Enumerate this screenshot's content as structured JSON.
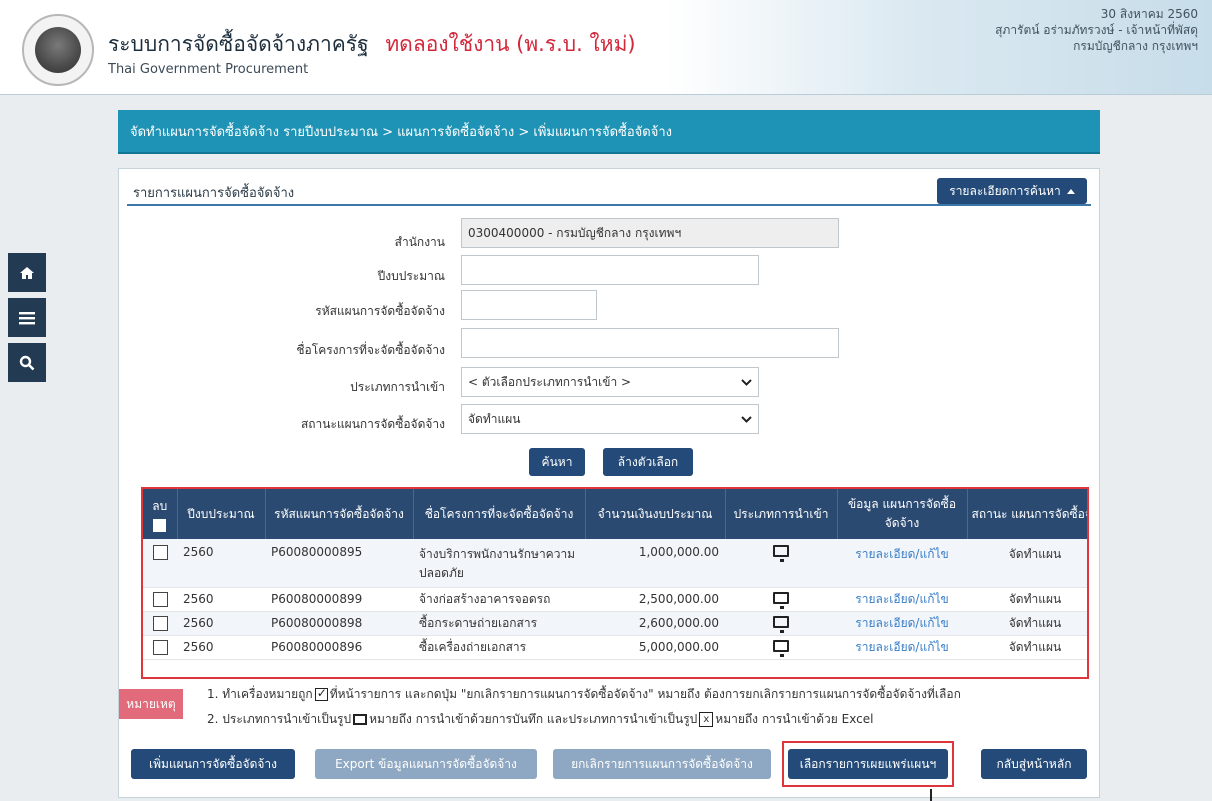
{
  "header": {
    "title": "ระบบการจัดซื้อจัดจ้างภาครัฐ",
    "trial_label": "ทดลองใช้งาน (พ.ร.บ. ใหม่)",
    "subtitle": "Thai Government Procurement",
    "date": "30 สิงหาคม 2560",
    "user": "สุภารัตน์ อร่ามภัทรวงษ์ - เจ้าหน้าที่พัสดุ",
    "department": "กรมบัญชีกลาง กรุงเทพฯ"
  },
  "sidenav": {
    "icons": [
      "home-icon",
      "menu-icon",
      "search-icon"
    ]
  },
  "breadcrumb": "จัดทำแผนการจัดซื้อจัดจ้าง รายปีงบประมาณ > แผนการจัดซื้อจัดจ้าง > เพิ่มแผนการจัดซื้อจัดจ้าง",
  "panel": {
    "title": "รายการแผนการจัดซื้อจัดจ้าง",
    "search_detail_button": "รายละเอียดการค้นหา"
  },
  "form": {
    "office_label": "สำนักงาน",
    "office_value": "0300400000 - กรมบัญชีกลาง กรุงเทพฯ",
    "budget_year_label": "ปีงบประมาณ",
    "budget_year_value": "",
    "plan_code_label": "รหัสแผนการจัดซื้อจัดจ้าง",
    "plan_code_value": "",
    "project_name_label": "ชื่อโครงการที่จะจัดซื้อจัดจ้าง",
    "project_name_value": "",
    "import_type_label": "ประเภทการนำเข้า",
    "import_type_value": "< ตัวเลือกประเภทการนำเข้า >",
    "plan_status_label": "สถานะแผนการจัดซื้อจัดจ้าง",
    "plan_status_value": "จัดทำแผน",
    "search_button": "ค้นหา",
    "clear_button": "ล้างตัวเลือก"
  },
  "table": {
    "headers": {
      "delete": "ลบ",
      "budget_year": "ปีงบประมาณ",
      "plan_code": "รหัสแผนการจัดซื้อจัดจ้าง",
      "project_name": "ชื่อโครงการที่จะจัดซื้อจัดจ้าง",
      "budget_amount": "จำนวนเงินงบประมาณ",
      "import_type": "ประเภทการนำเข้า",
      "plan_info": "ข้อมูล แผนการจัดซื้อจัดจ้าง",
      "status": "สถานะ แผนการจัดซื้อจัดจ้"
    },
    "rows": [
      {
        "year": "2560",
        "code": "P60080000895",
        "name": "จ้างบริการพนักงานรักษาความปลอดภัย",
        "amount": "1,000,000.00",
        "import_icon": "monitor-icon",
        "info": "รายละเอียด/แก้ไข",
        "status": "จัดทำแผน"
      },
      {
        "year": "2560",
        "code": "P60080000899",
        "name": "จ้างก่อสร้างอาคารจอดรถ",
        "amount": "2,500,000.00",
        "import_icon": "monitor-icon",
        "info": "รายละเอียด/แก้ไข",
        "status": "จัดทำแผน"
      },
      {
        "year": "2560",
        "code": "P60080000898",
        "name": "ซื้อกระดาษถ่ายเอกสาร",
        "amount": "2,600,000.00",
        "import_icon": "monitor-icon",
        "info": "รายละเอียด/แก้ไข",
        "status": "จัดทำแผน"
      },
      {
        "year": "2560",
        "code": "P60080000896",
        "name": "ซื้อเครื่องถ่ายเอกสาร",
        "amount": "5,000,000.00",
        "import_icon": "monitor-icon",
        "info": "รายละเอียด/แก้ไข",
        "status": "จัดทำแผน"
      }
    ]
  },
  "notes": {
    "badge": "หมายเหตุ",
    "line1_a": "1. ทำเครื่องหมายถูก",
    "line1_b": "ที่หน้ารายการ และกดปุ่ม \"ยกเลิกรายการแผนการจัดซื้อจัดจ้าง\" หมายถึง ต้องการยกเลิกรายการแผนการจัดซื้อจัดจ้างที่เลือก",
    "line2_a": "2. ประเภทการนำเข้าเป็นรูป",
    "line2_b": "หมายถึง การนำเข้าด้วยการบันทึก และประเภทการนำเข้าเป็นรูป",
    "line2_c": "หมายถึง การนำเข้าด้วย Excel",
    "excel_glyph": "x"
  },
  "actions": {
    "add_plan": "เพิ่มแผนการจัดซื้อจัดจ้าง",
    "export_plan": "Export ข้อมูลแผนการจัดซื้อจัดจ้าง",
    "cancel_plan": "ยกเลิกรายการแผนการจัดซื้อจัดจ้าง",
    "select_publish": "เลือกรายการเผยแพร่แผนฯ",
    "back_home": "กลับสู่หน้าหลัก"
  },
  "colors": {
    "header_trial": "#d3283a",
    "breadcrumb_bg": "#1e93b5",
    "table_header_bg": "#2b4a72",
    "button_dark": "#234a78",
    "button_muted": "#8ea7c2",
    "highlight_frame": "#e0353a",
    "link": "#3b7ec7"
  }
}
